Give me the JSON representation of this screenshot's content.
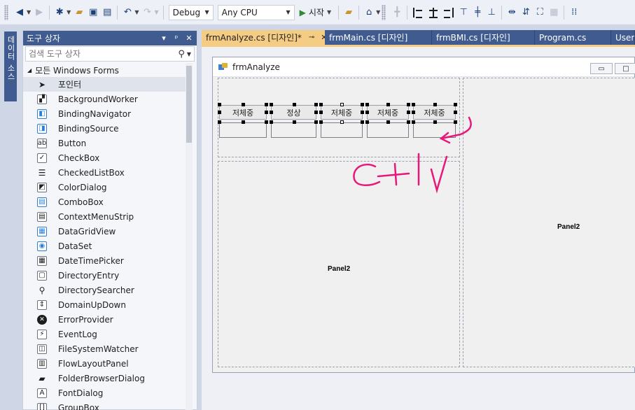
{
  "toolbar": {
    "config_select": "Debug",
    "platform_select": "Any CPU",
    "run_label": "시작"
  },
  "side_strip": {
    "tab_label": "데이터 소스"
  },
  "toolbox": {
    "title": "도구 상자",
    "search_placeholder": "검색 도구 상자",
    "group_label": "모든 Windows Forms",
    "items": [
      {
        "label": "포인터",
        "icon": "pointer-icon"
      },
      {
        "label": "BackgroundWorker",
        "icon": "background-worker-icon"
      },
      {
        "label": "BindingNavigator",
        "icon": "binding-navigator-icon"
      },
      {
        "label": "BindingSource",
        "icon": "binding-source-icon"
      },
      {
        "label": "Button",
        "icon": "button-icon"
      },
      {
        "label": "CheckBox",
        "icon": "checkbox-icon"
      },
      {
        "label": "CheckedListBox",
        "icon": "checked-listbox-icon"
      },
      {
        "label": "ColorDialog",
        "icon": "color-dialog-icon"
      },
      {
        "label": "ComboBox",
        "icon": "combobox-icon"
      },
      {
        "label": "ContextMenuStrip",
        "icon": "context-menu-icon"
      },
      {
        "label": "DataGridView",
        "icon": "datagridview-icon"
      },
      {
        "label": "DataSet",
        "icon": "dataset-icon"
      },
      {
        "label": "DateTimePicker",
        "icon": "datetimepicker-icon"
      },
      {
        "label": "DirectoryEntry",
        "icon": "directory-entry-icon"
      },
      {
        "label": "DirectorySearcher",
        "icon": "directory-searcher-icon"
      },
      {
        "label": "DomainUpDown",
        "icon": "domain-updown-icon"
      },
      {
        "label": "ErrorProvider",
        "icon": "error-provider-icon"
      },
      {
        "label": "EventLog",
        "icon": "eventlog-icon"
      },
      {
        "label": "FileSystemWatcher",
        "icon": "filesystemwatcher-icon"
      },
      {
        "label": "FlowLayoutPanel",
        "icon": "flowlayoutpanel-icon"
      },
      {
        "label": "FolderBrowserDialog",
        "icon": "folder-browser-icon"
      },
      {
        "label": "FontDialog",
        "icon": "font-dialog-icon"
      },
      {
        "label": "GroupBox",
        "icon": "groupbox-icon"
      }
    ]
  },
  "doc_tabs": [
    {
      "label": "frmAnalyze.cs [디자인]*",
      "active": true
    },
    {
      "label": "frmMain.cs [디자인]",
      "active": false
    },
    {
      "label": "frmBMI.cs [디자인]",
      "active": false
    },
    {
      "label": "Program.cs",
      "active": false
    },
    {
      "label": "User.",
      "active": false
    }
  ],
  "designer": {
    "form_title": "frmAnalyze",
    "buttons": [
      "저체중",
      "정상",
      "저체중",
      "저체중",
      "저체중"
    ],
    "panel_left_label": "Panel2",
    "panel_right_label": "Panel2"
  }
}
